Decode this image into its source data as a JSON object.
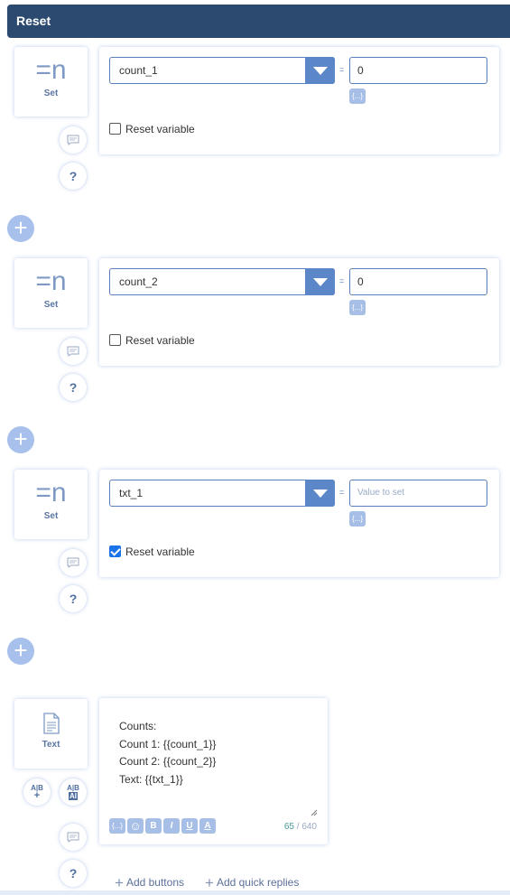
{
  "header": {
    "title": "Reset"
  },
  "set_blocks": [
    {
      "tile_icon_text": "=n",
      "tile_label": "Set",
      "variable": "count_1",
      "equals": "=",
      "value": "0",
      "value_placeholder": "",
      "var_button": "{...}",
      "reset_label": "Reset variable",
      "reset_checked": false
    },
    {
      "tile_icon_text": "=n",
      "tile_label": "Set",
      "variable": "count_2",
      "equals": "=",
      "value": "0",
      "value_placeholder": "",
      "var_button": "{...}",
      "reset_label": "Reset variable",
      "reset_checked": false
    },
    {
      "tile_icon_text": "=n",
      "tile_label": "Set",
      "variable": "txt_1",
      "equals": "=",
      "value": "",
      "value_placeholder": "Value to set",
      "var_button": "{...}",
      "reset_label": "Reset variable",
      "reset_checked": true
    }
  ],
  "help_label": "?",
  "plus_label": "+",
  "text_block": {
    "tile_label": "Text",
    "lines": [
      "Counts:",
      "Count 1: {{count_1}}",
      "Count 2: {{count_2}}",
      "Text: {{txt_1}}"
    ],
    "format_buttons": [
      "{...}",
      "☺",
      "B",
      "I",
      "U",
      "A"
    ],
    "char_count": "65",
    "char_sep": " / ",
    "char_max": "640",
    "ab_add": {
      "top": "A|B",
      "bottom": "+"
    },
    "ab_ai": {
      "top": "A|B",
      "bottom": "AI"
    }
  },
  "footer": {
    "add_buttons": "Add buttons",
    "add_quick_replies": "Add quick replies"
  }
}
